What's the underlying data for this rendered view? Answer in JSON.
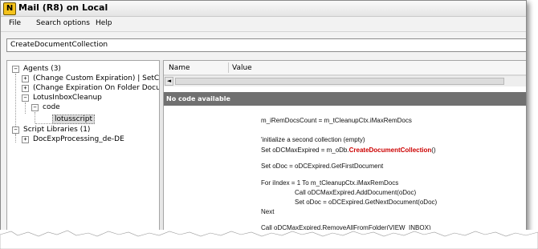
{
  "window": {
    "title": "Mail (R8) on Local",
    "app_icon_letter": "N"
  },
  "menu": {
    "items": [
      "File",
      "Search options",
      "Help"
    ]
  },
  "search": {
    "value": "CreateDocumentCollection"
  },
  "tree": {
    "agents_label": "Agents (3)",
    "agent_1": "(Change Custom Expiration)  | SetCus",
    "agent_2": "(Change Expiration On Folder Docume",
    "agent_3": "LotusInboxCleanup",
    "code_label": "code",
    "lotusscript_label": "lotusscript",
    "script_libraries_label": "Script Libraries (1)",
    "library_1": "DocExpProcessing_de-DE",
    "expand_symbol": "+",
    "collapse_symbol": "−"
  },
  "properties": {
    "col_name": "Name",
    "col_value": "Value",
    "scroll_left_symbol": "◄"
  },
  "code": {
    "banner": "No code available",
    "line_1": "m_iRemDocsCount = m_tCleanupCtx.iMaxRemDocs",
    "line_2": "'initialize a second collection (empty)",
    "line_3_pre": "Set oDCMaxExpired = m_oDb.",
    "line_3_hl": "CreateDocumentCollection",
    "line_3_post": "()",
    "line_4": "Set oDoc = oDCExpired.GetFirstDocument",
    "line_5": "For iIndex = 1 To m_tCleanupCtx.iMaxRemDocs",
    "line_6": "Call oDCMaxExpired.AddDocument(oDoc)",
    "line_7": "Set oDoc = oDCExpired.GetNextDocument(oDoc)",
    "line_8": "Next",
    "line_9": "Call oDCMaxExpired.RemoveAllFromFolder(VIEW_INBOX)"
  },
  "colors": {
    "highlight": "#cc0000",
    "banner_bg": "#707070",
    "app_icon": "#f4c21b"
  }
}
